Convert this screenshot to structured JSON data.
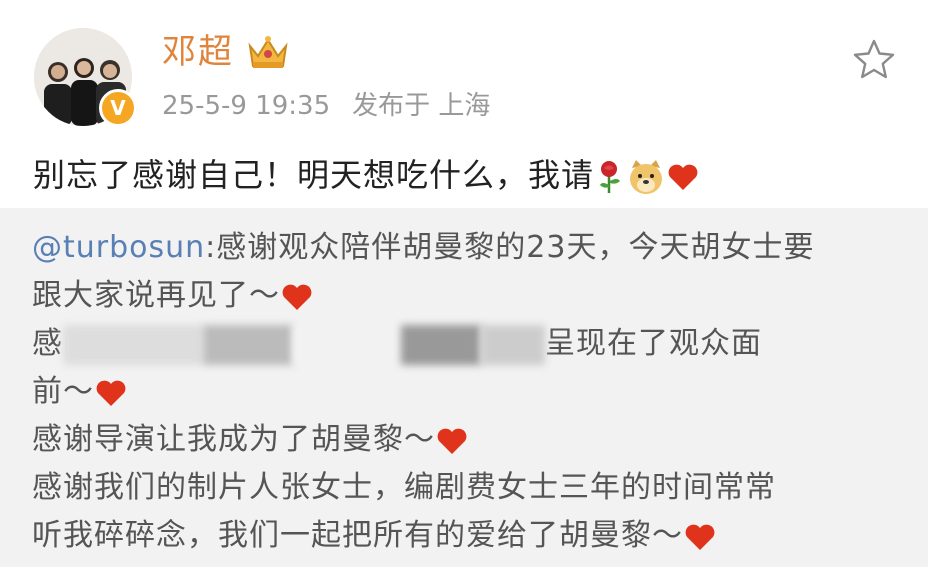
{
  "user": {
    "name": "邓超",
    "verified_badge": "V",
    "date": "25-5-9 19:35",
    "location": "发布于 上海"
  },
  "post": {
    "text": "别忘了感谢自己！明天想吃什么，我请"
  },
  "repost": {
    "mention": "@turbosun",
    "line1_rest": ":感谢观众陪伴胡曼黎的23天，今天胡女士要",
    "line2": "跟大家说再见了～",
    "line3_start": "感",
    "line3_end": "呈现在了观众面",
    "line4": "前～",
    "line5": "感谢导演让我成为了胡曼黎～",
    "line6": "感谢我们的制片人张女士，编剧费女士三年的时间常常",
    "line7": "听我碎碎念，我们一起把所有的爱给了胡曼黎～"
  },
  "icons": {
    "avatar": "group-photo",
    "crown": "crown-icon",
    "favorite": "star-icon",
    "emojis": [
      "rose-icon",
      "doge-icon",
      "heart-icon"
    ]
  },
  "colors": {
    "username": "#e0843b",
    "mention": "#5a7fb5",
    "repost_bg": "#f2f2f2",
    "heart": "#e0331c"
  }
}
